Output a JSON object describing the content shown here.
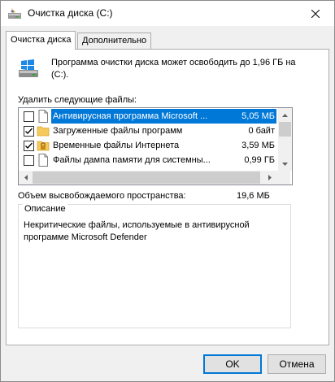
{
  "window": {
    "title": "Очистка диска  (C:)"
  },
  "tabs": [
    {
      "label": "Очистка диска"
    },
    {
      "label": "Дополнительно"
    }
  ],
  "intro": "Программа очистки диска может освободить до 1,96 ГБ на  (C:).",
  "files": {
    "label": "Удалить следующие файлы:",
    "items": [
      {
        "name": "Антивирусная программа Microsoft ...",
        "size": "5,05 МБ",
        "checked": false,
        "selected": true,
        "icon": "blank-page-icon"
      },
      {
        "name": "Загруженные файлы программ",
        "size": "0 байт",
        "checked": true,
        "selected": false,
        "icon": "folder-icon"
      },
      {
        "name": "Временные файлы Интернета",
        "size": "3,59 МБ",
        "checked": true,
        "selected": false,
        "icon": "locked-folder-icon"
      },
      {
        "name": "Файлы дампа памяти для системны...",
        "size": "0,99 ГБ",
        "checked": false,
        "selected": false,
        "icon": "blank-page-icon"
      }
    ]
  },
  "space": {
    "label": "Объем высвобождаемого пространства:",
    "value": "19,6 МБ"
  },
  "description": {
    "legend": "Описание",
    "text": "Некритические файлы, используемые в антивирусной программе Microsoft Defender"
  },
  "buttons": {
    "ok": "OK",
    "cancel": "Отмена"
  },
  "colors": {
    "selection": "#0078d7",
    "folder": "#f5c95b",
    "background": "#f0f0f0"
  }
}
